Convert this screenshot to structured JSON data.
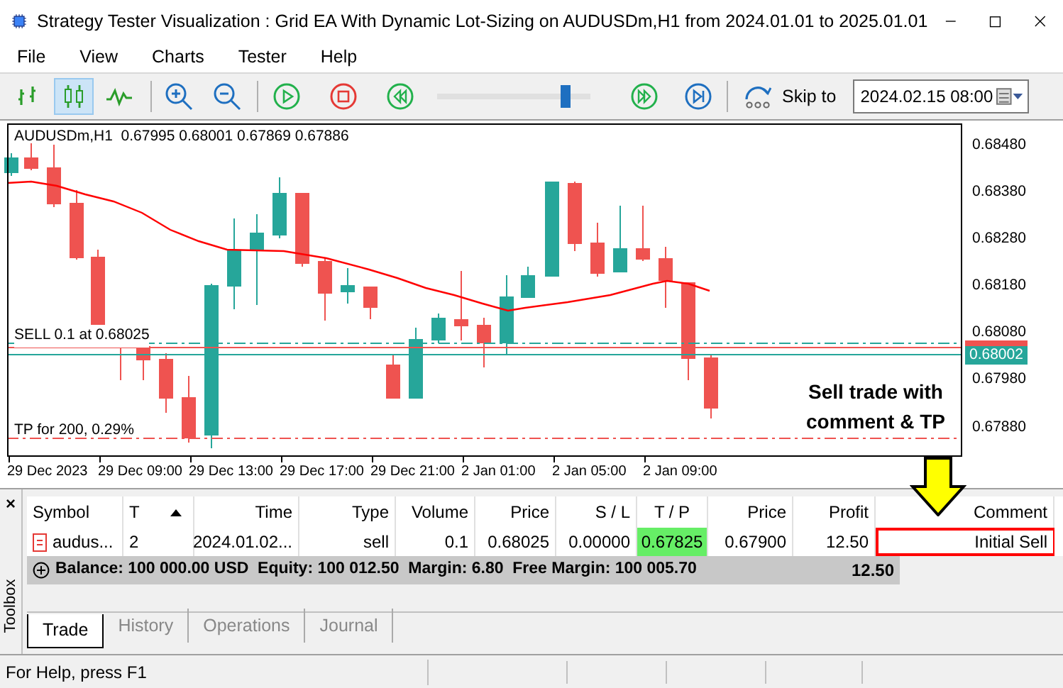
{
  "window": {
    "title": "Strategy Tester Visualization : Grid EA With Dynamic Lot-Sizing on AUDUSDm,H1 from 2024.01.01 to 2025.01.01"
  },
  "menu": [
    "File",
    "View",
    "Charts",
    "Tester",
    "Help"
  ],
  "toolbar": {
    "chart_modes": [
      {
        "kind": "bars",
        "selected": false
      },
      {
        "kind": "candles",
        "selected": true
      },
      {
        "kind": "line",
        "selected": false
      }
    ],
    "speed": {
      "level": 0.84
    },
    "skip_label": "Skip to",
    "skip_date": "2024.02.15 08:00"
  },
  "chart": {
    "header": "AUDUSDm,H1  0.67995 0.68001 0.67869 0.67886",
    "price_labels": [
      "0.68480",
      "0.68380",
      "0.68280",
      "0.68180",
      "0.68080",
      "0.67980",
      "0.67880"
    ],
    "current_price": "0.68002",
    "time_labels": [
      "29 Dec 2023",
      "29 Dec 09:00",
      "29 Dec 13:00",
      "29 Dec 17:00",
      "29 Dec 21:00",
      "2 Jan 01:00",
      "2 Jan 05:00",
      "2 Jan 09:00"
    ],
    "order_label": "SELL 0.1 at 0.68025",
    "tp_label": "TP for 200, 0.29%",
    "callout": "Sell trade with comment & TP"
  },
  "table": {
    "columns": [
      {
        "label": "Symbol",
        "sorted": false
      },
      {
        "label": "T",
        "sorted": true
      },
      {
        "label": "Time",
        "sorted": false
      },
      {
        "label": "Type",
        "sorted": false
      },
      {
        "label": "Volume",
        "sorted": false
      },
      {
        "label": "Price",
        "sorted": false
      },
      {
        "label": "S / L",
        "sorted": false
      },
      {
        "label": "T / P",
        "sorted": false
      },
      {
        "label": "Price",
        "sorted": false
      },
      {
        "label": "Profit",
        "sorted": false
      },
      {
        "label": "Comment",
        "sorted": false
      }
    ],
    "rows": [
      {
        "cells": [
          {
            "text": "audus...",
            "highlighted": false
          },
          {
            "text": "2",
            "highlighted": false
          },
          {
            "text": "2024.01.02...",
            "highlighted": false
          },
          {
            "text": "sell",
            "highlighted": false
          },
          {
            "text": "0.1",
            "highlighted": false
          },
          {
            "text": "0.68025",
            "highlighted": false
          },
          {
            "text": "0.00000",
            "highlighted": false
          },
          {
            "text": "0.67825",
            "highlighted": true
          },
          {
            "text": "0.67900",
            "highlighted": false
          },
          {
            "text": "12.50",
            "highlighted": false
          },
          {
            "text": "Initial Sell",
            "highlighted": false
          }
        ]
      }
    ],
    "summary": "Balance: 100 000.00 USD  Equity: 100 012.50  Margin: 6.80  Free Margin: 100 005.70",
    "summary_profit": "12.50"
  },
  "toolbox": {
    "label": "Toolbox",
    "close": "×"
  },
  "tabs": [
    {
      "label": "Trade",
      "selected": true
    },
    {
      "label": "History",
      "selected": false
    },
    {
      "label": "Operations",
      "selected": false
    },
    {
      "label": "Journal",
      "selected": false
    }
  ],
  "status_bar": "For Help, press F1"
}
